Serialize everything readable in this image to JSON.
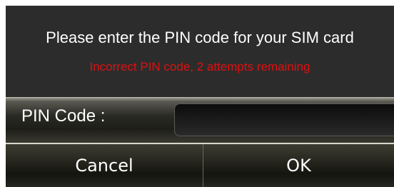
{
  "dialog": {
    "message": "Please enter the PIN code for your SIM card",
    "error": "Incorrect PIN code, 2 attempts remaining",
    "pin_label": "PIN Code :",
    "pin_value": "",
    "cancel_label": "Cancel",
    "ok_label": "OK"
  },
  "colors": {
    "background": "#2b2b2b",
    "message_text": "#ffffff",
    "error_text": "#e01010",
    "button_text": "#ffffff"
  }
}
